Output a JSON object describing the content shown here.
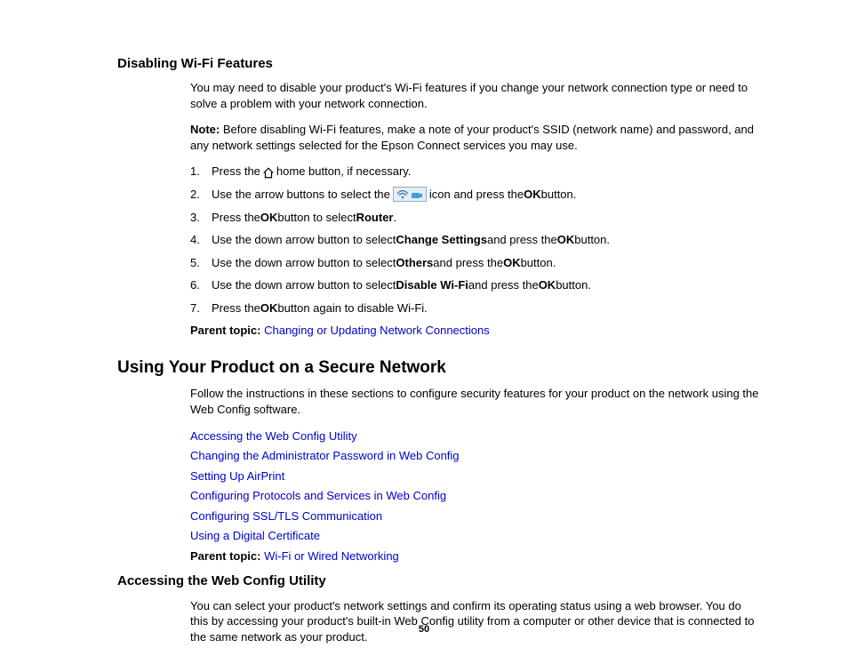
{
  "section1": {
    "heading": "Disabling Wi-Fi Features",
    "intro": "You may need to disable your product's Wi-Fi features if you change your network connection type or need to solve a problem with your network connection.",
    "note_label": "Note:",
    "note_text": " Before disabling Wi-Fi features, make a note of your product's SSID (network name) and password, and any network settings selected for the Epson Connect services you may use.",
    "steps": {
      "s1_a": "Press the ",
      "s1_b": " home button, if necessary.",
      "s2_a": "Use the arrow buttons to select the ",
      "s2_b": " icon and press the ",
      "s2_ok": "OK",
      "s2_c": " button.",
      "s3_a": "Press the ",
      "s3_ok": "OK",
      "s3_b": " button to select ",
      "s3_router": "Router",
      "s3_c": ".",
      "s4_a": "Use the down arrow button to select ",
      "s4_cs": "Change Settings",
      "s4_b": " and press the ",
      "s4_ok": "OK",
      "s4_c": " button.",
      "s5_a": "Use the down arrow button to select ",
      "s5_oth": "Others",
      "s5_b": " and press the ",
      "s5_ok": "OK",
      "s5_c": " button.",
      "s6_a": "Use the down arrow button to select ",
      "s6_dw": "Disable Wi-Fi",
      "s6_b": " and press the ",
      "s6_ok": "OK",
      "s6_c": " button.",
      "s7_a": "Press the ",
      "s7_ok": "OK",
      "s7_b": " button again to disable Wi-Fi."
    },
    "parent_label": "Parent topic:",
    "parent_link": "Changing or Updating Network Connections"
  },
  "section2": {
    "heading": "Using Your Product on a Secure Network",
    "intro": "Follow the instructions in these sections to configure security features for your product on the network using the Web Config software.",
    "links": [
      "Accessing the Web Config Utility",
      "Changing the Administrator Password in Web Config",
      "Setting Up AirPrint",
      "Configuring Protocols and Services in Web Config",
      "Configuring SSL/TLS Communication",
      "Using a Digital Certificate"
    ],
    "parent_label": "Parent topic:",
    "parent_link": "Wi-Fi or Wired Networking"
  },
  "section3": {
    "heading": "Accessing the Web Config Utility",
    "intro": "You can select your product's network settings and confirm its operating status using a web browser. You do this by accessing your product's built-in Web Config utility from a computer or other device that is connected to the same network as your product."
  },
  "page_number": "50"
}
